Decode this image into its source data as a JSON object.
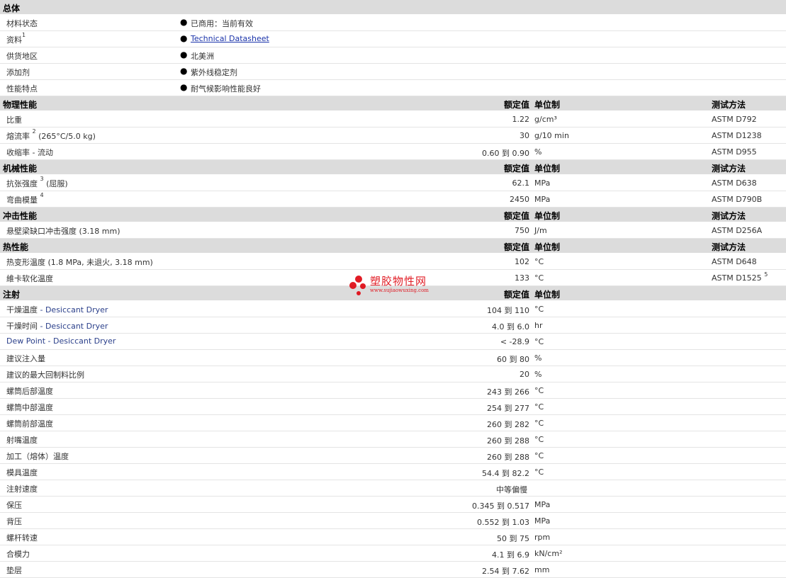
{
  "headers": {
    "nominal": "额定值",
    "unit": "单位制",
    "test": "测试方法"
  },
  "general": {
    "title": "总体",
    "rows": [
      {
        "label": "材料状态",
        "sup": "",
        "value": "已商用：当前有效",
        "link": false
      },
      {
        "label": "资料",
        "sup": "1",
        "value": "Technical Datasheet",
        "link": true
      },
      {
        "label": "供货地区",
        "sup": "",
        "value": "北美洲",
        "link": false
      },
      {
        "label": "添加剂",
        "sup": "",
        "value": "紫外线稳定剂",
        "link": false
      },
      {
        "label": "性能特点",
        "sup": "",
        "value": "耐气候影响性能良好",
        "link": false
      }
    ]
  },
  "physical": {
    "title": "物理性能",
    "rows": [
      {
        "label": "比重",
        "sup": "",
        "cond": "",
        "nominal": "1.22",
        "unit": "g/cm³",
        "test": "ASTM D792",
        "test_sup": ""
      },
      {
        "label": "熔流率",
        "sup": "2",
        "cond": "(265°C/5.0 kg)",
        "nominal": "30",
        "unit": "g/10 min",
        "test": "ASTM D1238",
        "test_sup": ""
      },
      {
        "label": "收缩率",
        "sup": "",
        "cond": "- 流动",
        "nominal": "0.60 到  0.90",
        "unit": "%",
        "test": "ASTM D955",
        "test_sup": ""
      }
    ]
  },
  "mechanical": {
    "title": "机械性能",
    "rows": [
      {
        "label": "抗张强度",
        "sup": "3",
        "cond": "(屈服)",
        "nominal": "62.1",
        "unit": "MPa",
        "test": "ASTM D638",
        "test_sup": ""
      },
      {
        "label": "弯曲模量",
        "sup": "4",
        "cond": "",
        "nominal": "2450",
        "unit": "MPa",
        "test": "ASTM D790B",
        "test_sup": ""
      }
    ]
  },
  "impact": {
    "title": "冲击性能",
    "rows": [
      {
        "label": "悬壁梁缺口冲击强度",
        "sup": "",
        "cond": "(3.18 mm)",
        "nominal": "750",
        "unit": "J/m",
        "test": "ASTM D256A",
        "test_sup": ""
      }
    ]
  },
  "thermal": {
    "title": "热性能",
    "rows": [
      {
        "label": "热变形温度",
        "sup": "",
        "cond": "(1.8 MPa, 未退火, 3.18 mm)",
        "nominal": "102",
        "unit": "°C",
        "test": "ASTM D648",
        "test_sup": ""
      },
      {
        "label": "維卡软化温度",
        "sup": "",
        "cond": "",
        "nominal": "133",
        "unit": "°C",
        "test": "ASTM D1525",
        "test_sup": "5"
      }
    ]
  },
  "injection": {
    "title": "注射",
    "rows": [
      {
        "label": "干燥温度",
        "cond": "- Desiccant Dryer",
        "nominal": "104 到  110",
        "unit": "°C"
      },
      {
        "label": "干燥时间",
        "cond": "- Desiccant Dryer",
        "nominal": "4.0 到  6.0",
        "unit": "hr"
      },
      {
        "label": "Dew Point - Desiccant Dryer",
        "cond": "",
        "nominal": "< -28.9",
        "unit": "°C"
      },
      {
        "label": "建议注入量",
        "cond": "",
        "nominal": "60 到  80",
        "unit": "%"
      },
      {
        "label": "建议的最大回制料比例",
        "cond": "",
        "nominal": "20",
        "unit": "%"
      },
      {
        "label": "螺筒后部温度",
        "cond": "",
        "nominal": "243 到  266",
        "unit": "°C"
      },
      {
        "label": "螺筒中部温度",
        "cond": "",
        "nominal": "254 到  277",
        "unit": "°C"
      },
      {
        "label": "螺筒前部温度",
        "cond": "",
        "nominal": "260 到  282",
        "unit": "°C"
      },
      {
        "label": "射嘴温度",
        "cond": "",
        "nominal": "260 到  288",
        "unit": "°C"
      },
      {
        "label": "加工（熔体）温度",
        "cond": "",
        "nominal": "260 到  288",
        "unit": "°C"
      },
      {
        "label": "模具温度",
        "cond": "",
        "nominal": "54.4 到  82.2",
        "unit": "°C"
      },
      {
        "label": "注射速度",
        "cond": "",
        "nominal": "中等偏慢",
        "unit": ""
      },
      {
        "label": "保压",
        "cond": "",
        "nominal": "0.345 到  0.517",
        "unit": "MPa"
      },
      {
        "label": "背压",
        "cond": "",
        "nominal": "0.552 到  1.03",
        "unit": "MPa"
      },
      {
        "label": "螺杆转速",
        "cond": "",
        "nominal": "50 到  75",
        "unit": "rpm"
      },
      {
        "label": "合模力",
        "cond": "",
        "nominal": "4.1 到  6.9",
        "unit": "kN/cm²"
      },
      {
        "label": "垫层",
        "cond": "",
        "nominal": "2.54 到  7.62",
        "unit": "mm"
      }
    ]
  },
  "watermark": {
    "name": "塑胶物性网",
    "url": "www.sujiaowuxing.com",
    "color": "#e0101a"
  }
}
